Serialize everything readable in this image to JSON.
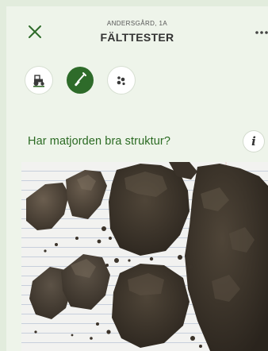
{
  "header": {
    "subtitle": "ANDERSGÅRD, 1A",
    "title": "FÄLTTESTER",
    "close_icon": "close-icon",
    "more_icon": "more-horizontal-icon"
  },
  "toolbar": {
    "buttons": [
      {
        "icon": "tractor-icon",
        "active": false
      },
      {
        "icon": "spade-icon",
        "active": true
      },
      {
        "icon": "soil-particles-icon",
        "active": false
      }
    ]
  },
  "question": {
    "text": "Har matjorden bra struktur?",
    "info_label": "i"
  },
  "colors": {
    "accent": "#2e6b2a",
    "question_text": "#2a6a22",
    "background": "#eef4ea"
  }
}
